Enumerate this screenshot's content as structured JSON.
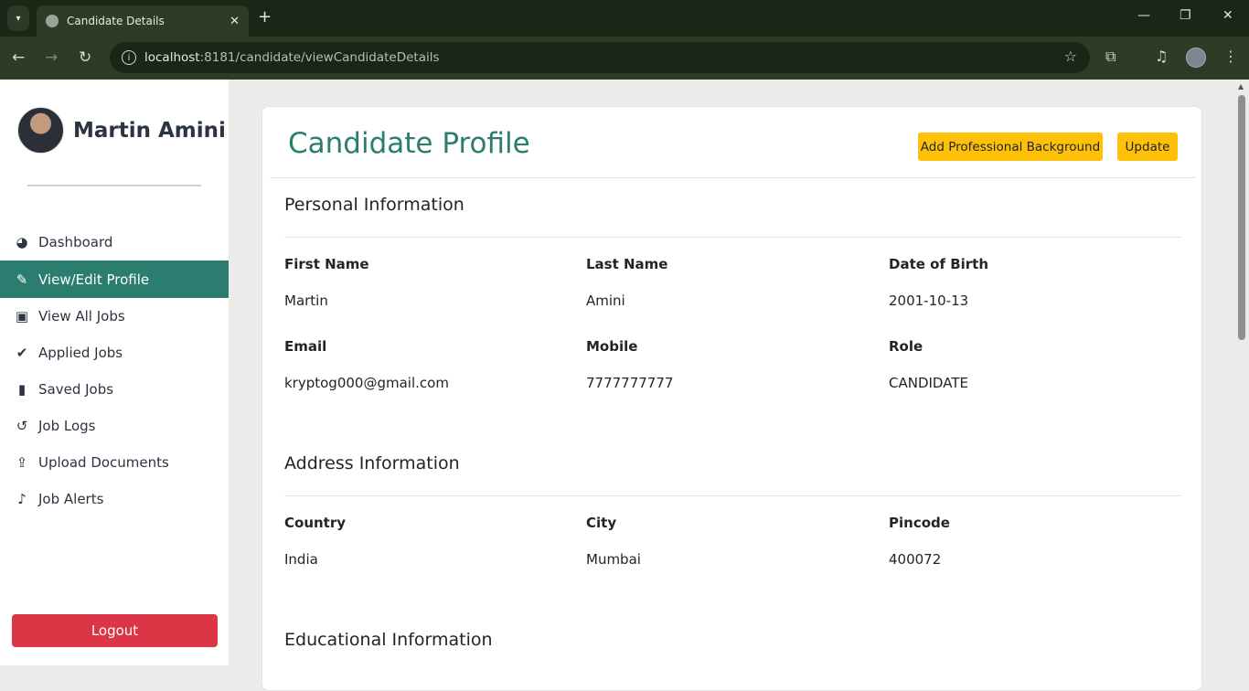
{
  "browser": {
    "tab_title": "Candidate Details",
    "url_host": "localhost",
    "url_path": ":8181/candidate/viewCandidateDetails"
  },
  "sidebar": {
    "user_name": "Martin Amini",
    "items": [
      {
        "label": "Dashboard",
        "icon": "gauge-icon"
      },
      {
        "label": "View/Edit Profile",
        "icon": "user-edit-icon"
      },
      {
        "label": "View All Jobs",
        "icon": "briefcase-icon"
      },
      {
        "label": "Applied Jobs",
        "icon": "check-circle-icon"
      },
      {
        "label": "Saved Jobs",
        "icon": "bookmark-icon"
      },
      {
        "label": "Job Logs",
        "icon": "history-icon"
      },
      {
        "label": "Upload Documents",
        "icon": "file-upload-icon"
      },
      {
        "label": "Job Alerts",
        "icon": "bell-icon"
      }
    ],
    "logout_label": "Logout"
  },
  "profile": {
    "title": "Candidate Profile",
    "add_background_label": "Add Professional Background",
    "update_label": "Update",
    "personal": {
      "title": "Personal Information",
      "first_name_label": "First Name",
      "first_name": "Martin",
      "last_name_label": "Last Name",
      "last_name": "Amini",
      "dob_label": "Date of Birth",
      "dob": "2001-10-13",
      "email_label": "Email",
      "email": "kryptog000@gmail.com",
      "mobile_label": "Mobile",
      "mobile": "7777777777",
      "role_label": "Role",
      "role": "CANDIDATE"
    },
    "address": {
      "title": "Address Information",
      "country_label": "Country",
      "country": "India",
      "city_label": "City",
      "city": "Mumbai",
      "pincode_label": "Pincode",
      "pincode": "400072"
    },
    "education": {
      "title": "Educational Information"
    }
  },
  "colors": {
    "accent": "#2a7d6f",
    "warning": "#ffc107",
    "danger": "#dc3545"
  }
}
